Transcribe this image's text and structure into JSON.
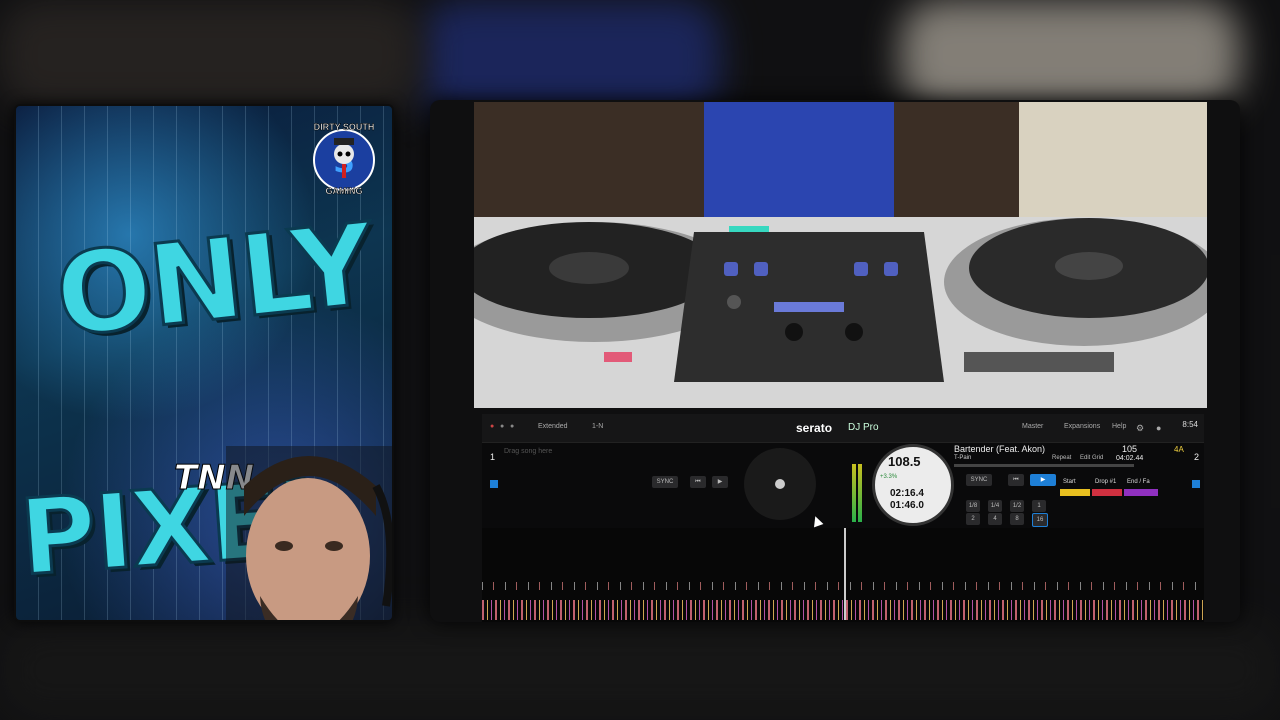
{
  "overlay": {
    "logo_line1": "ONLY",
    "logo_mid": "TNN",
    "logo_line2": "PIXEL",
    "badge_top": "DIRTY SOUTH",
    "badge_bottom": "GAMING"
  },
  "serato": {
    "brand": "serato",
    "product": "DJ Pro",
    "menu": {
      "master": "Master",
      "expansions": "Expansions",
      "help": "Help"
    },
    "clock": "8:54",
    "left_deck": {
      "number": "1",
      "mode": "Extended",
      "slot": "1-N",
      "placeholder": "Drag song here",
      "sync_label": "SYNC"
    },
    "right_deck": {
      "number": "2",
      "track_title": "Bartender (Feat. Akon)",
      "artist": "T-Pain",
      "bpm": "105",
      "key": "4A",
      "total_time": "04:02.44",
      "repeat_label": "Repeat",
      "edit_grid": "Edit Grid",
      "sync_label": "SYNC",
      "platter_bpm": "108.5",
      "platter_pitch": "+3.3%",
      "elapsed": "02:16.4",
      "remaining": "01:46.0",
      "loops": [
        "1/8",
        "1/4",
        "1/2",
        "1"
      ],
      "loops_row2": [
        "2",
        "4",
        "8",
        "16"
      ],
      "cue_labels": [
        "Start",
        "Drop #1",
        "End / Fa"
      ],
      "colors": {
        "play": "#1e7fd6",
        "cue1": "#e8c020",
        "cue2": "#d03040",
        "cue3": "#9030c0"
      }
    }
  }
}
